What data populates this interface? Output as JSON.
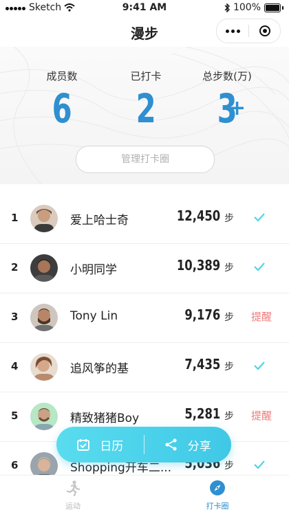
{
  "status_bar": {
    "carrier": "Sketch",
    "time": "9:41 AM",
    "battery": "100%"
  },
  "nav": {
    "title": "漫步",
    "more_icon": "more-dots-icon",
    "target_icon": "target-icon"
  },
  "stats": [
    {
      "label": "成员数",
      "value": "6"
    },
    {
      "label": "已打卡",
      "value": "2"
    },
    {
      "label": "总步数(万)",
      "value": "3",
      "suffix": "+"
    }
  ],
  "manage_button": "管理打卡圈",
  "step_unit": "步",
  "members": [
    {
      "rank": "1",
      "name": "爱上哈士奇",
      "steps": "12,450",
      "status": "checked"
    },
    {
      "rank": "2",
      "name": "小明同学",
      "steps": "10,389",
      "status": "checked"
    },
    {
      "rank": "3",
      "name": "Tony Lin",
      "steps": "9,176",
      "status": "remind",
      "status_text": "提醒"
    },
    {
      "rank": "4",
      "name": "追风筝的基",
      "steps": "7,435",
      "status": "checked"
    },
    {
      "rank": "5",
      "name": "精致猪猪Boy",
      "steps": "5,281",
      "status": "remind",
      "status_text": "提醒"
    },
    {
      "rank": "6",
      "name": "Shopping开车二...",
      "steps": "5,036",
      "status": "checked"
    }
  ],
  "float_actions": {
    "calendar": "日历",
    "share": "分享"
  },
  "tabs": [
    {
      "label": "运动",
      "icon": "running-icon",
      "active": false
    },
    {
      "label": "打卡圈",
      "icon": "compass-icon",
      "active": true
    }
  ],
  "colors": {
    "accent": "#2f8fd0",
    "teal": "#4fd2ea",
    "remind": "#ef7a7a",
    "tab_active": "#2f8fd0"
  }
}
